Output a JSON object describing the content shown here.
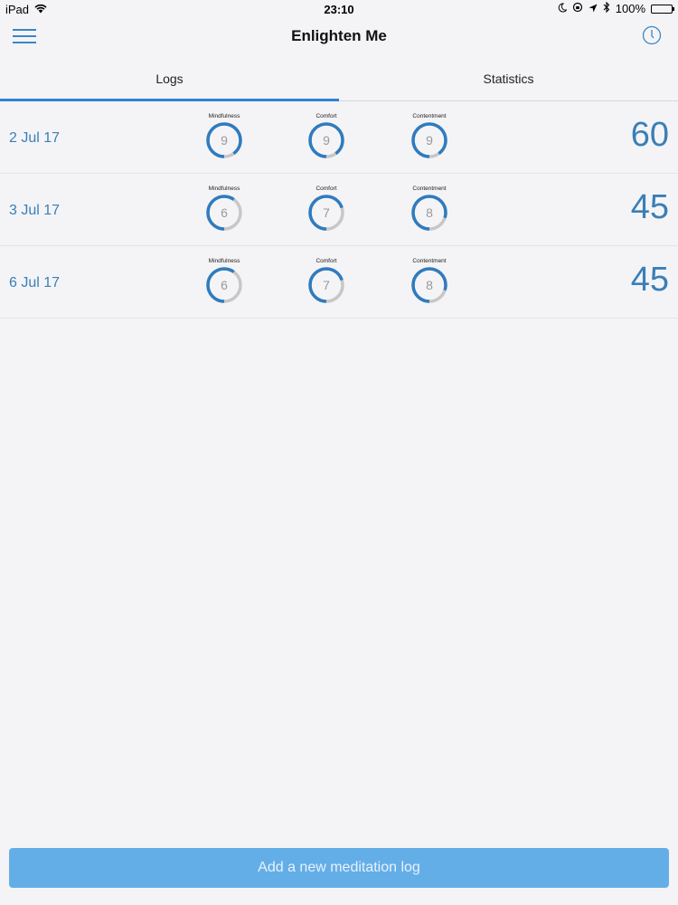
{
  "status_bar": {
    "device": "iPad",
    "time": "23:10",
    "battery": "100%"
  },
  "nav": {
    "title": "Enlighten Me"
  },
  "tabs": [
    {
      "label": "Logs",
      "selected": true
    },
    {
      "label": "Statistics",
      "selected": false
    }
  ],
  "logs": [
    {
      "date": "2 Jul 17",
      "duration": "60",
      "metrics": [
        {
          "label": "Mindfulness",
          "value": 9
        },
        {
          "label": "Comfort",
          "value": 9
        },
        {
          "label": "Contentment",
          "value": 9
        }
      ]
    },
    {
      "date": "3 Jul 17",
      "duration": "45",
      "metrics": [
        {
          "label": "Mindfulness",
          "value": 6
        },
        {
          "label": "Comfort",
          "value": 7
        },
        {
          "label": "Contentment",
          "value": 8
        }
      ]
    },
    {
      "date": "6 Jul 17",
      "duration": "45",
      "metrics": [
        {
          "label": "Mindfulness",
          "value": 6
        },
        {
          "label": "Comfort",
          "value": 7
        },
        {
          "label": "Contentment",
          "value": 8
        }
      ]
    }
  ],
  "gauge_max": 10,
  "colors": {
    "accent": "#3a7fb7",
    "tab_indicator": "#2f80d5",
    "gauge_fill": "#2f7bbf",
    "gauge_track": "#c7c7c7",
    "button": "#64aee8"
  },
  "footer": {
    "add_label": "Add a new meditation log"
  }
}
